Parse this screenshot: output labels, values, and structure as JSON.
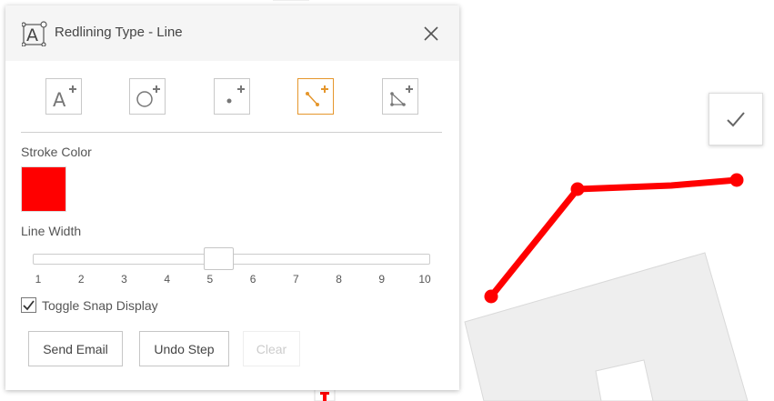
{
  "panel": {
    "title": "Redlining Type - Line",
    "tools": [
      {
        "name": "text",
        "active": false
      },
      {
        "name": "circle",
        "active": false
      },
      {
        "name": "point",
        "active": false
      },
      {
        "name": "line",
        "active": true
      },
      {
        "name": "polygon",
        "active": false
      }
    ],
    "stroke_color_label": "Stroke Color",
    "stroke_color": "#ff0000",
    "line_width_label": "Line Width",
    "line_width": {
      "min": 1,
      "max": 10,
      "value": 5.2,
      "ticks": [
        "1",
        "2",
        "3",
        "4",
        "5",
        "6",
        "7",
        "8",
        "9",
        "10"
      ]
    },
    "snap": {
      "label": "Toggle Snap Display",
      "checked": true
    },
    "buttons": {
      "send_email": "Send Email",
      "undo_step": "Undo Step",
      "clear": "Clear"
    }
  },
  "colors": {
    "accent": "#e5962c",
    "drawing": "#ff0000"
  }
}
